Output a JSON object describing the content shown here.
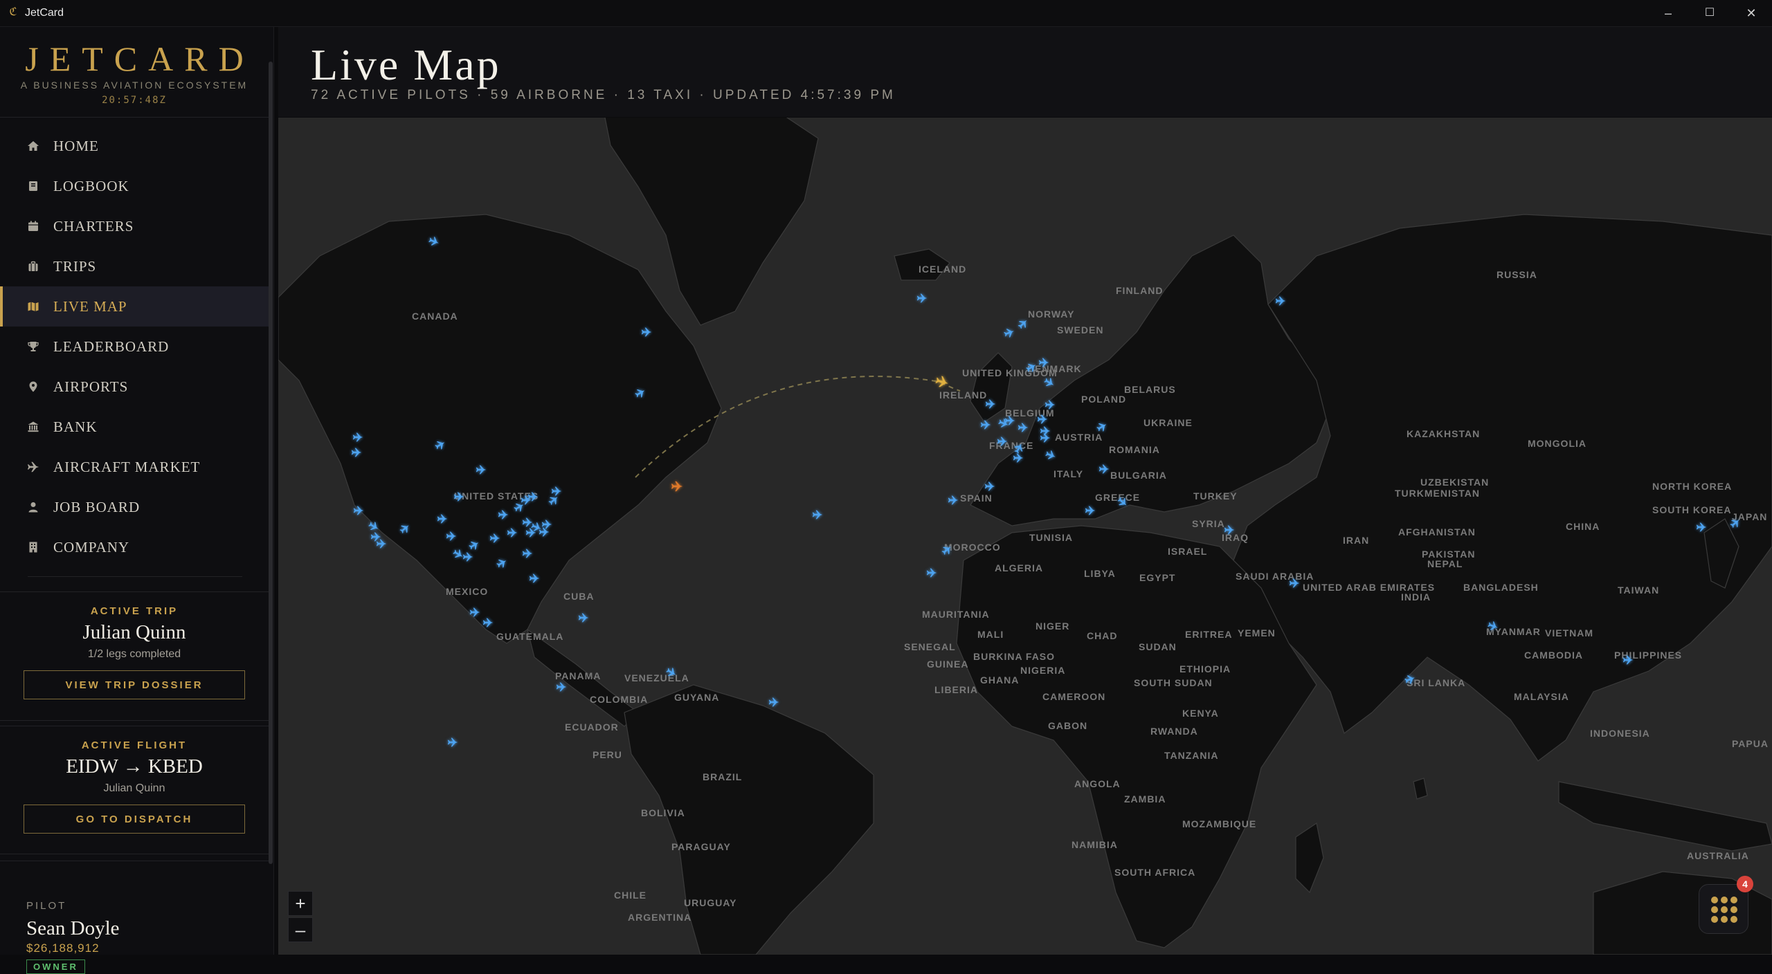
{
  "window": {
    "title": "JetCard",
    "minimize": "–",
    "maximize": "☐",
    "close": "✕"
  },
  "brand": {
    "name": "JETCARD",
    "tagline": "A BUSINESS AVIATION ECOSYSTEM",
    "clock": "20:57:48Z"
  },
  "nav": [
    {
      "label": "HOME",
      "icon": "home-icon"
    },
    {
      "label": "LOGBOOK",
      "icon": "book-icon"
    },
    {
      "label": "CHARTERS",
      "icon": "calendar-icon"
    },
    {
      "label": "TRIPS",
      "icon": "suitcase-icon"
    },
    {
      "label": "LIVE MAP",
      "icon": "map-icon",
      "active": true
    },
    {
      "label": "LEADERBOARD",
      "icon": "trophy-icon"
    },
    {
      "label": "AIRPORTS",
      "icon": "map-pin-icon"
    },
    {
      "label": "BANK",
      "icon": "bank-icon"
    },
    {
      "label": "AIRCRAFT MARKET",
      "icon": "plane-icon"
    },
    {
      "label": "JOB BOARD",
      "icon": "person-icon"
    },
    {
      "label": "COMPANY",
      "icon": "building-icon"
    }
  ],
  "active_trip": {
    "label": "ACTIVE TRIP",
    "name": "Julian Quinn",
    "progress": "1/2 legs completed",
    "button": "VIEW TRIP DOSSIER"
  },
  "active_flight": {
    "label": "ACTIVE FLIGHT",
    "route": "EIDW → KBED",
    "pilot": "Julian Quinn",
    "button": "GO TO DISPATCH"
  },
  "pilot": {
    "label": "PILOT",
    "name": "Sean Doyle",
    "balance": "$26,188,912",
    "role": "OWNER"
  },
  "header": {
    "title": "Live Map",
    "subtitle": "72 ACTIVE PILOTS · 59 AIRBORNE · 13 TAXI · UPDATED 4:57:39 PM"
  },
  "map": {
    "zoom_in": "+",
    "zoom_out": "–",
    "labels": [
      "ICELAND",
      "CANADA",
      "NORWAY",
      "SWEDEN",
      "FINLAND",
      "RUSSIA",
      "UNITED KINGDOM",
      "IRELAND",
      "DENMARK",
      "BELARUS",
      "POLAND",
      "UKRAINE",
      "BELGIUM",
      "AUSTRIA",
      "FRANCE",
      "ROMANIA",
      "ITALY",
      "BULGARIA",
      "SPAIN",
      "GREECE",
      "TURKEY",
      "KAZAKHSTAN",
      "MONGOLIA",
      "UZBEKISTAN",
      "TURKMENISTAN",
      "NORTH KOREA",
      "SOUTH KOREA",
      "JAPAN",
      "CHINA",
      "AFGHANISTAN",
      "PAKISTAN",
      "IRAN",
      "IRAQ",
      "SYRIA",
      "ISRAEL",
      "TUNISIA",
      "MOROCCO",
      "ALGERIA",
      "LIBYA",
      "EGYPT",
      "SAUDI ARABIA",
      "UNITED ARAB EMIRATES",
      "YEMEN",
      "ERITREA",
      "NEPAL",
      "INDIA",
      "BANGLADESH",
      "MYANMAR",
      "TAIWAN",
      "VIETNAM",
      "CAMBODIA",
      "PHILIPPINES",
      "MALAYSIA",
      "SRI LANKA",
      "INDONESIA",
      "PAPUA GUINEA",
      "AUSTRALIA",
      "UNITED STATES",
      "MEXICO",
      "CUBA",
      "GUATEMALA",
      "PANAMA",
      "VENEZUELA",
      "COLOMBIA",
      "GUYANA",
      "ECUADOR",
      "PERU",
      "BRAZIL",
      "BOLIVIA",
      "PARAGUAY",
      "CHILE",
      "URUGUAY",
      "ARGENTINA",
      "MAURITANIA",
      "MALI",
      "NIGER",
      "CHAD",
      "SUDAN",
      "SENEGAL",
      "BURKINA FASO",
      "GUINEA",
      "GHANA",
      "NIGERIA",
      "SOUTH SUDAN",
      "ETHIOPIA",
      "LIBERIA",
      "CAMEROON",
      "KENYA",
      "GABON",
      "RWANDA",
      "TANZANIA",
      "ANGOLA",
      "ZAMBIA",
      "MOZAMBIQUE",
      "NAMIBIA",
      "SOUTH AFRICA"
    ]
  },
  "apps": {
    "badge": "4"
  },
  "colors": {
    "accent": "#c9a24e",
    "plane": "#4ea3f0",
    "active_plane": "#e0b040",
    "alert_plane": "#e07a2a",
    "badge": "#d9433b"
  }
}
